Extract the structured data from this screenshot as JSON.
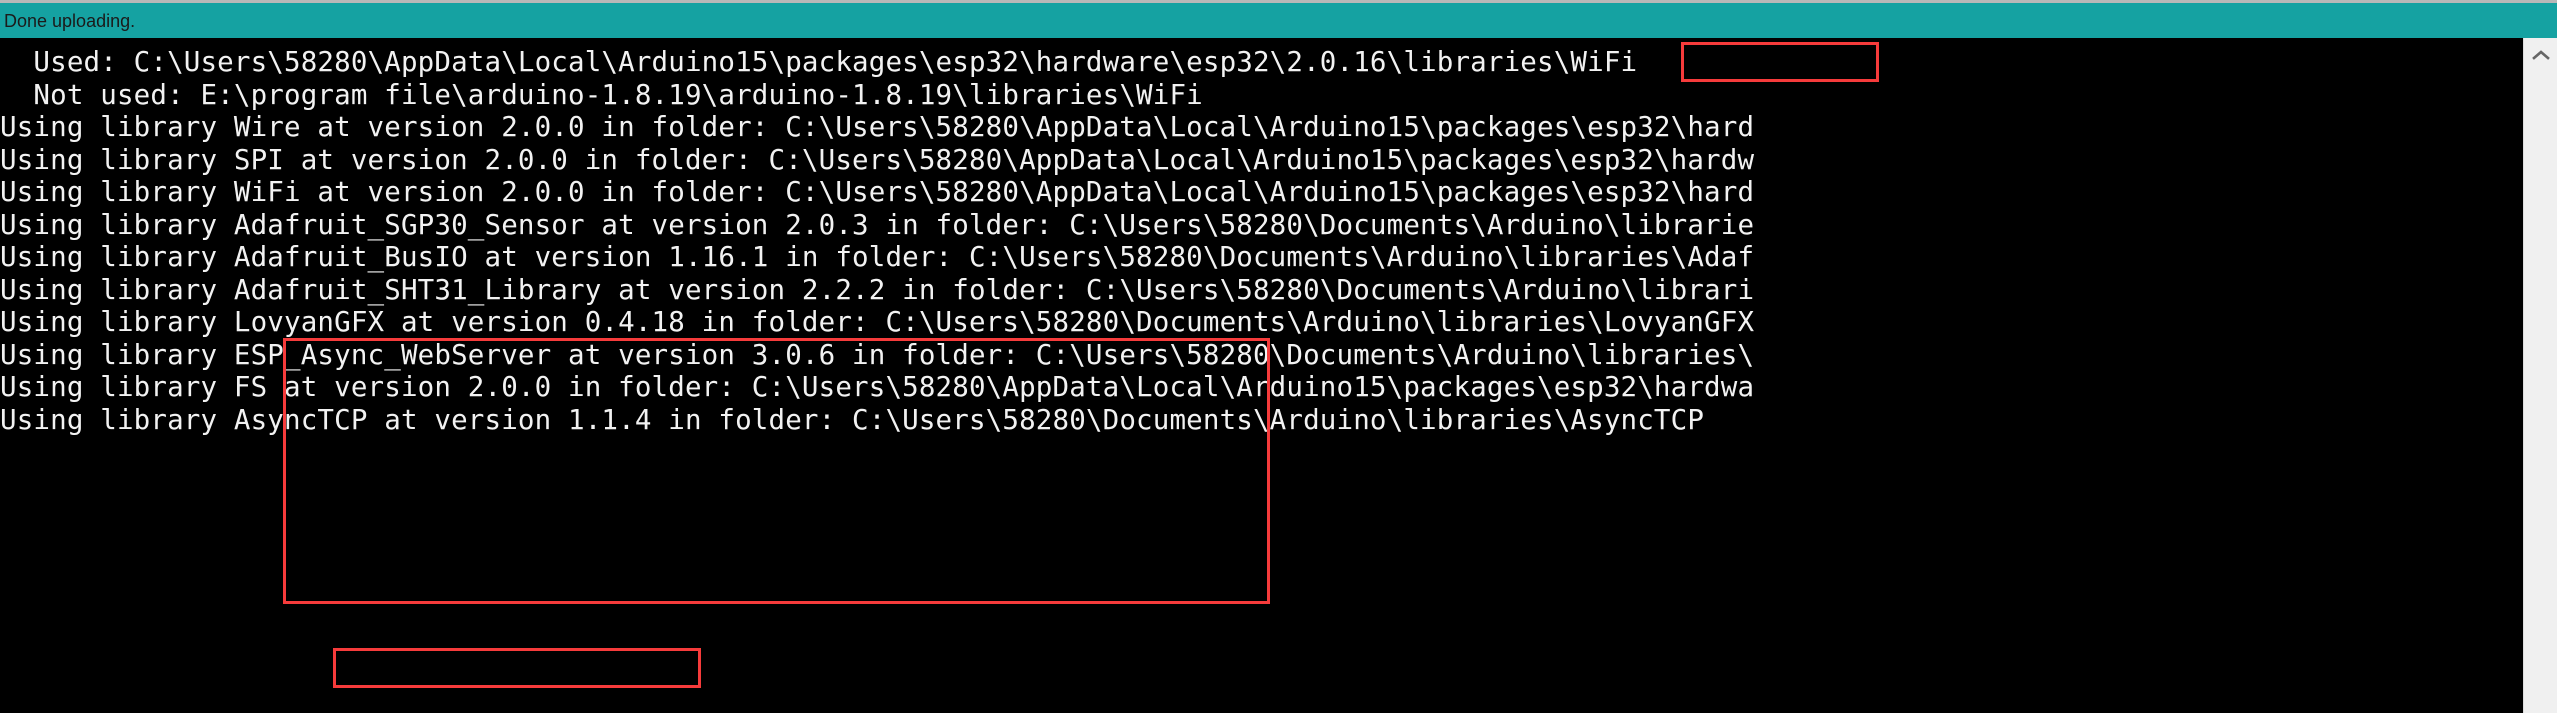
{
  "status_bar": {
    "message": "Done uploading.",
    "background_color": "#15a2a2",
    "text_color": "#1b1b1b"
  },
  "console": {
    "background_color": "#000000",
    "text_color": "#f2f2f2",
    "lines": [
      "  Used: C:\\Users\\58280\\AppData\\Local\\Arduino15\\packages\\esp32\\hardware\\esp32\\2.0.16\\libraries\\WiFi",
      "  Not used: E:\\program file\\arduino-1.8.19\\arduino-1.8.19\\libraries\\WiFi",
      "Using library Wire at version 2.0.0 in folder: C:\\Users\\58280\\AppData\\Local\\Arduino15\\packages\\esp32\\hard",
      "Using library SPI at version 2.0.0 in folder: C:\\Users\\58280\\AppData\\Local\\Arduino15\\packages\\esp32\\hardw",
      "Using library WiFi at version 2.0.0 in folder: C:\\Users\\58280\\AppData\\Local\\Arduino15\\packages\\esp32\\hard",
      "Using library Adafruit_SGP30_Sensor at version 2.0.3 in folder: C:\\Users\\58280\\Documents\\Arduino\\librarie",
      "Using library Adafruit_BusIO at version 1.16.1 in folder: C:\\Users\\58280\\Documents\\Arduino\\libraries\\Adaf",
      "Using library Adafruit_SHT31_Library at version 2.2.2 in folder: C:\\Users\\58280\\Documents\\Arduino\\librari",
      "Using library LovyanGFX at version 0.4.18 in folder: C:\\Users\\58280\\Documents\\Arduino\\libraries\\LovyanGFX",
      "Using library ESP_Async_WebServer at version 3.0.6 in folder: C:\\Users\\58280\\Documents\\Arduino\\libraries\\",
      "Using library FS at version 2.0.0 in folder: C:\\Users\\58280\\AppData\\Local\\Arduino15\\packages\\esp32\\hardwa",
      "Using library AsyncTCP at version 1.1.4 in folder: C:\\Users\\58280\\Documents\\Arduino\\libraries\\AsyncTCP"
    ]
  },
  "annotations": {
    "color": "#f63b3b",
    "boxes": [
      {
        "name": "esp32-version-highlight",
        "text": "esp32\\2.0.16\\"
      },
      {
        "name": "libraries-group-highlight",
        "text": "Adafruit_SGP30_Sensor at version 2.0.3 / Adafruit_BusIO at version 1.16.1 / Adafruit_SHT31_Library at version 2.2.2 / LovyanGFX at version 0.4.18 / ESP_Async_WebServer at version 3.0.6"
      },
      {
        "name": "asynctcp-highlight",
        "text": "AsyncTCP at version 1.1.4"
      }
    ]
  },
  "scrollbar": {
    "up_arrow_icon": "chevron-up-icon",
    "track_color": "#f0f0f0"
  }
}
